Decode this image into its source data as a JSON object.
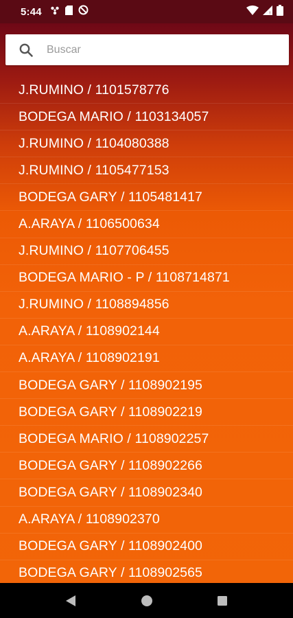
{
  "status_bar": {
    "time": "5:44",
    "left_icons": [
      "fan-icon",
      "sim-card-icon",
      "blocked-notification-icon"
    ],
    "right_icons": [
      "wifi-icon",
      "cell-signal-icon",
      "battery-icon"
    ]
  },
  "search": {
    "placeholder": "Buscar",
    "value": ""
  },
  "items": [
    "J.RUMINO / 1101578776",
    "BODEGA MARIO / 1103134057",
    "J.RUMINO / 1104080388",
    "J.RUMINO / 1105477153",
    "BODEGA GARY / 1105481417",
    "A.ARAYA / 1106500634",
    "J.RUMINO / 1107706455",
    "BODEGA MARIO - P / 1108714871",
    "J.RUMINO / 1108894856",
    "A.ARAYA / 1108902144",
    "A.ARAYA / 1108902191",
    "BODEGA GARY / 1108902195",
    "BODEGA GARY / 1108902219",
    "BODEGA MARIO / 1108902257",
    "BODEGA GARY / 1108902266",
    "BODEGA GARY / 1108902340",
    "A.ARAYA / 1108902370",
    "BODEGA GARY / 1108902400",
    "BODEGA GARY / 1108902565"
  ],
  "colors": {
    "gradient_top": "#6e0816",
    "gradient_bottom": "#f26508",
    "status_bar": "#5a0a14",
    "nav_bar": "#000000"
  }
}
